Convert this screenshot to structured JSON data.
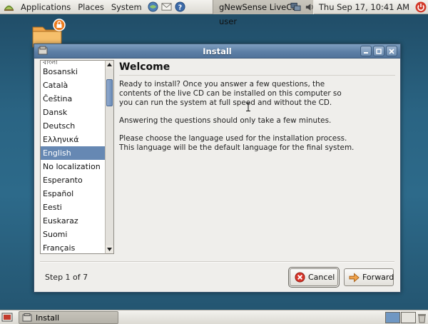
{
  "top_panel": {
    "menus": [
      "Applications",
      "Places",
      "System"
    ],
    "window_button": "gNewSense LiveCD user",
    "clock": "Thu Sep 17, 10:41 AM"
  },
  "window": {
    "title": "Install",
    "languages": [
      {
        "label": "বাংলা",
        "selected": false
      },
      {
        "label": "Bosanski",
        "selected": false
      },
      {
        "label": "Català",
        "selected": false
      },
      {
        "label": "Čeština",
        "selected": false
      },
      {
        "label": "Dansk",
        "selected": false
      },
      {
        "label": "Deutsch",
        "selected": false
      },
      {
        "label": "Ελληνικά",
        "selected": false
      },
      {
        "label": "English",
        "selected": true
      },
      {
        "label": "No localization",
        "selected": false
      },
      {
        "label": "Esperanto",
        "selected": false
      },
      {
        "label": "Español",
        "selected": false
      },
      {
        "label": "Eesti",
        "selected": false
      },
      {
        "label": "Euskaraz",
        "selected": false
      },
      {
        "label": "Suomi",
        "selected": false
      },
      {
        "label": "Français",
        "selected": false
      }
    ],
    "heading": "Welcome",
    "paragraphs": [
      "Ready to install? Once you answer a few questions, the\ncontents of the live CD can be installed on this computer so\nyou can run the system at full speed and without the CD.",
      "Answering the questions should only take a few minutes.",
      "Please choose the language used for the installation process.\nThis language will be the default language for the final system."
    ],
    "step": "Step 1 of 7",
    "cancel_label": "Cancel",
    "forward_label": "Forward"
  },
  "bottom_panel": {
    "task_label": "Install"
  },
  "colors": {
    "selection": "#6688b3",
    "titlebar": "#5d7fa5",
    "desktop": "#2a6483"
  },
  "icons": [
    "gnewsense-logo-icon",
    "browser-icon",
    "mail-icon",
    "help-icon",
    "network-icon",
    "volume-icon",
    "power-icon",
    "folder-lock-icon",
    "cancel-icon",
    "forward-arrow-icon",
    "show-desktop-icon",
    "trash-icon"
  ]
}
